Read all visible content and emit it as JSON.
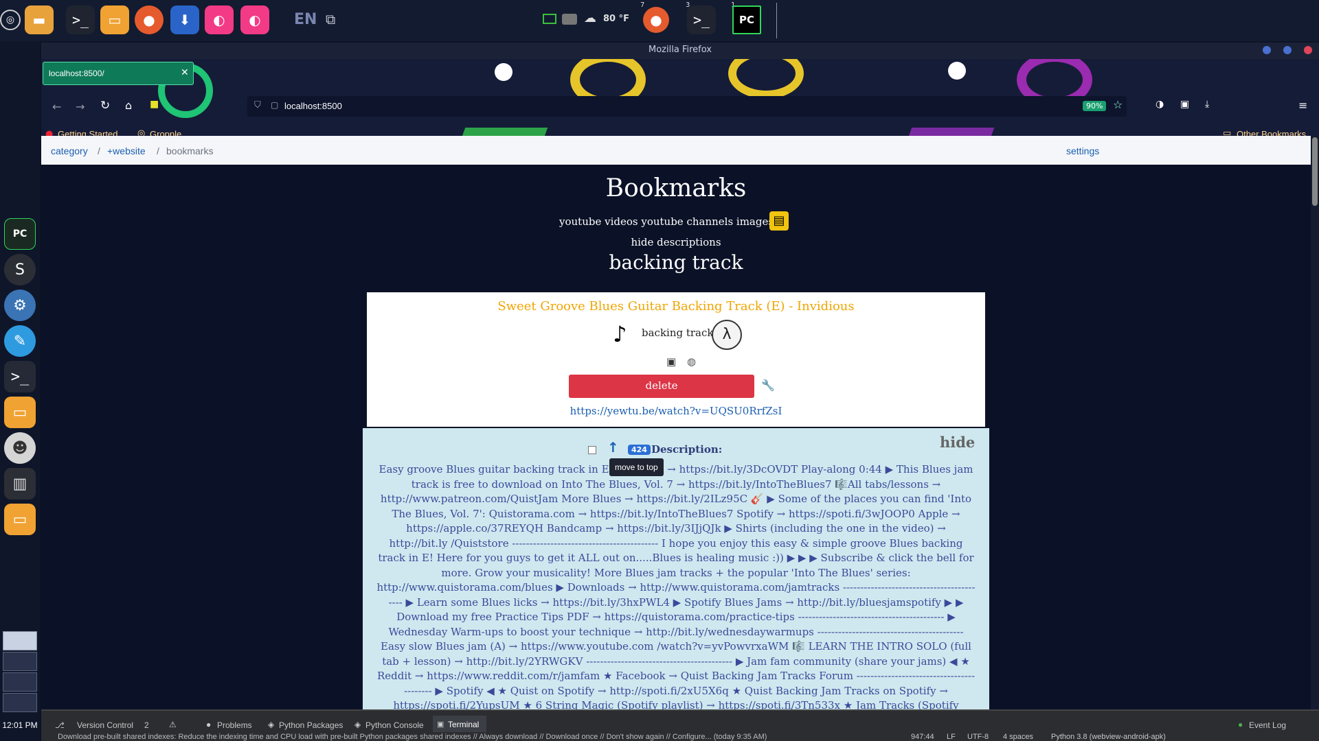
{
  "desktop": {
    "top_panel": {
      "lang": "EN",
      "weather": "80 °F",
      "badge_firefox": "7",
      "badge_terminal": "3",
      "badge_pycharm": "1",
      "pycharm_label": "PC"
    },
    "clock": "12:01 PM"
  },
  "firefox": {
    "window_title": "Mozilla Firefox",
    "tab_title": "localhost:8500/",
    "url": "localhost:8500",
    "zoom": "90%",
    "bookmarks_bar": [
      "Getting Started",
      "Gropple"
    ],
    "other_bookmarks": "Other Bookmarks"
  },
  "page": {
    "breadcrumb": {
      "items": [
        "category",
        "+website",
        "bookmarks"
      ],
      "separators": [
        "/",
        "/"
      ]
    },
    "settings": "settings",
    "title": "Bookmarks",
    "filters": "youtube videos youtube channels images",
    "hide_descriptions": "hide descriptions",
    "section": "backing track",
    "bookmark": {
      "title": "Sweet Groove Blues Guitar Backing Track (E) - Invidious",
      "tag": "backing track",
      "delete_label": "delete",
      "url": "https://yewtu.be/watch?v=UQSU0RrfZsI",
      "hide_label": "hide",
      "count": "424",
      "description_label": "Description:",
      "tooltip": "move to top",
      "description": "Easy groove Blues guitar backing track in E! ▶ Lesson → https://bit.ly/3DcOVDT Play-along 0:44 ▶ This Blues jam track is free to download on Into The Blues, Vol. 7 → https://bit.ly/IntoTheBlues7 🎼All tabs/lessons → http://www.patreon.com/QuistJam More Blues → https://bit.ly/2ILz95C 🎸 ▶ Some of the places you can find 'Into The Blues, Vol. 7': Quistorama.com → https://bit.ly/IntoTheBlues7 Spotify → https://spoti.fi/3wJOOP0 Apple → https://apple.co/37REYQH Bandcamp → https://bit.ly/3IJjQJk ▶ Shirts (including the one in the video) → http://bit.ly /Quiststore ------------------------------------------ I hope you enjoy this easy & simple groove Blues backing track in E! Here for you guys to get it ALL out on.....Blues is healing music :)) ▶ ▶ ▶ Subscribe & click the bell for more. Grow your musicality! More Blues jam tracks + the popular 'Into The Blues' series: http://www.quistorama.com/blues ▶ Downloads → http://www.quistorama.com/jamtracks ------------------------------------------ ▶ Learn some Blues licks → https://bit.ly/3hxPWL4 ▶ Spotify Blues Jams → http://bit.ly/bluesjamspotify ▶ ▶ Download my free Practice Tips PDF → https://quistorama.com/practice-tips ------------------------------------------ ▶ Wednesday Warm-ups to boost your technique → http://bit.ly/wednesdaywarmups ------------------------------------------ Easy slow Blues jam (A) → https://www.youtube.com /watch?v=yvPowvrxaWM 🎼 LEARN THE INTRO SOLO (full tab + lesson) → http://bit.ly/2YRWGKV ------------------------------------------ ▶ Jam fam community (share your jams) ◀ ★ Reddit → https://www.reddit.com/r/jamfam ★ Facebook → Quist Backing Jam Tracks Forum ------------------------------------------ ▶ Spotify ◀ ★ Quist on Spotify → http://spoti.fi/2xU5X6q ★ Quist Backing Jam Tracks on Spotify → https://spoti.fi/2YupsUM ★ 6 String Magic (Spotify playlist) → https://spoti.fi/3Tn533x ★ Jam Tracks (Spotify playlist) → http://bit.ly/jamtracks ★ Blues Backing Tracks"
    }
  },
  "ide": {
    "tools": [
      "Version Control",
      "Problems",
      "Python Packages",
      "Python Console",
      "Terminal"
    ],
    "todo_count": "2",
    "event_log": "Event Log",
    "status_message": "Download pre-built shared indexes: Reduce the indexing time and CPU load with pre-built Python packages shared indexes // Always download // Download once // Don't show again // Configure... (today 9:35 AM)",
    "position": "947:44",
    "line_sep": "LF",
    "encoding": "UTF-8",
    "indent": "4 spaces",
    "interpreter": "Python 3.8 (webview-android-apk)"
  }
}
